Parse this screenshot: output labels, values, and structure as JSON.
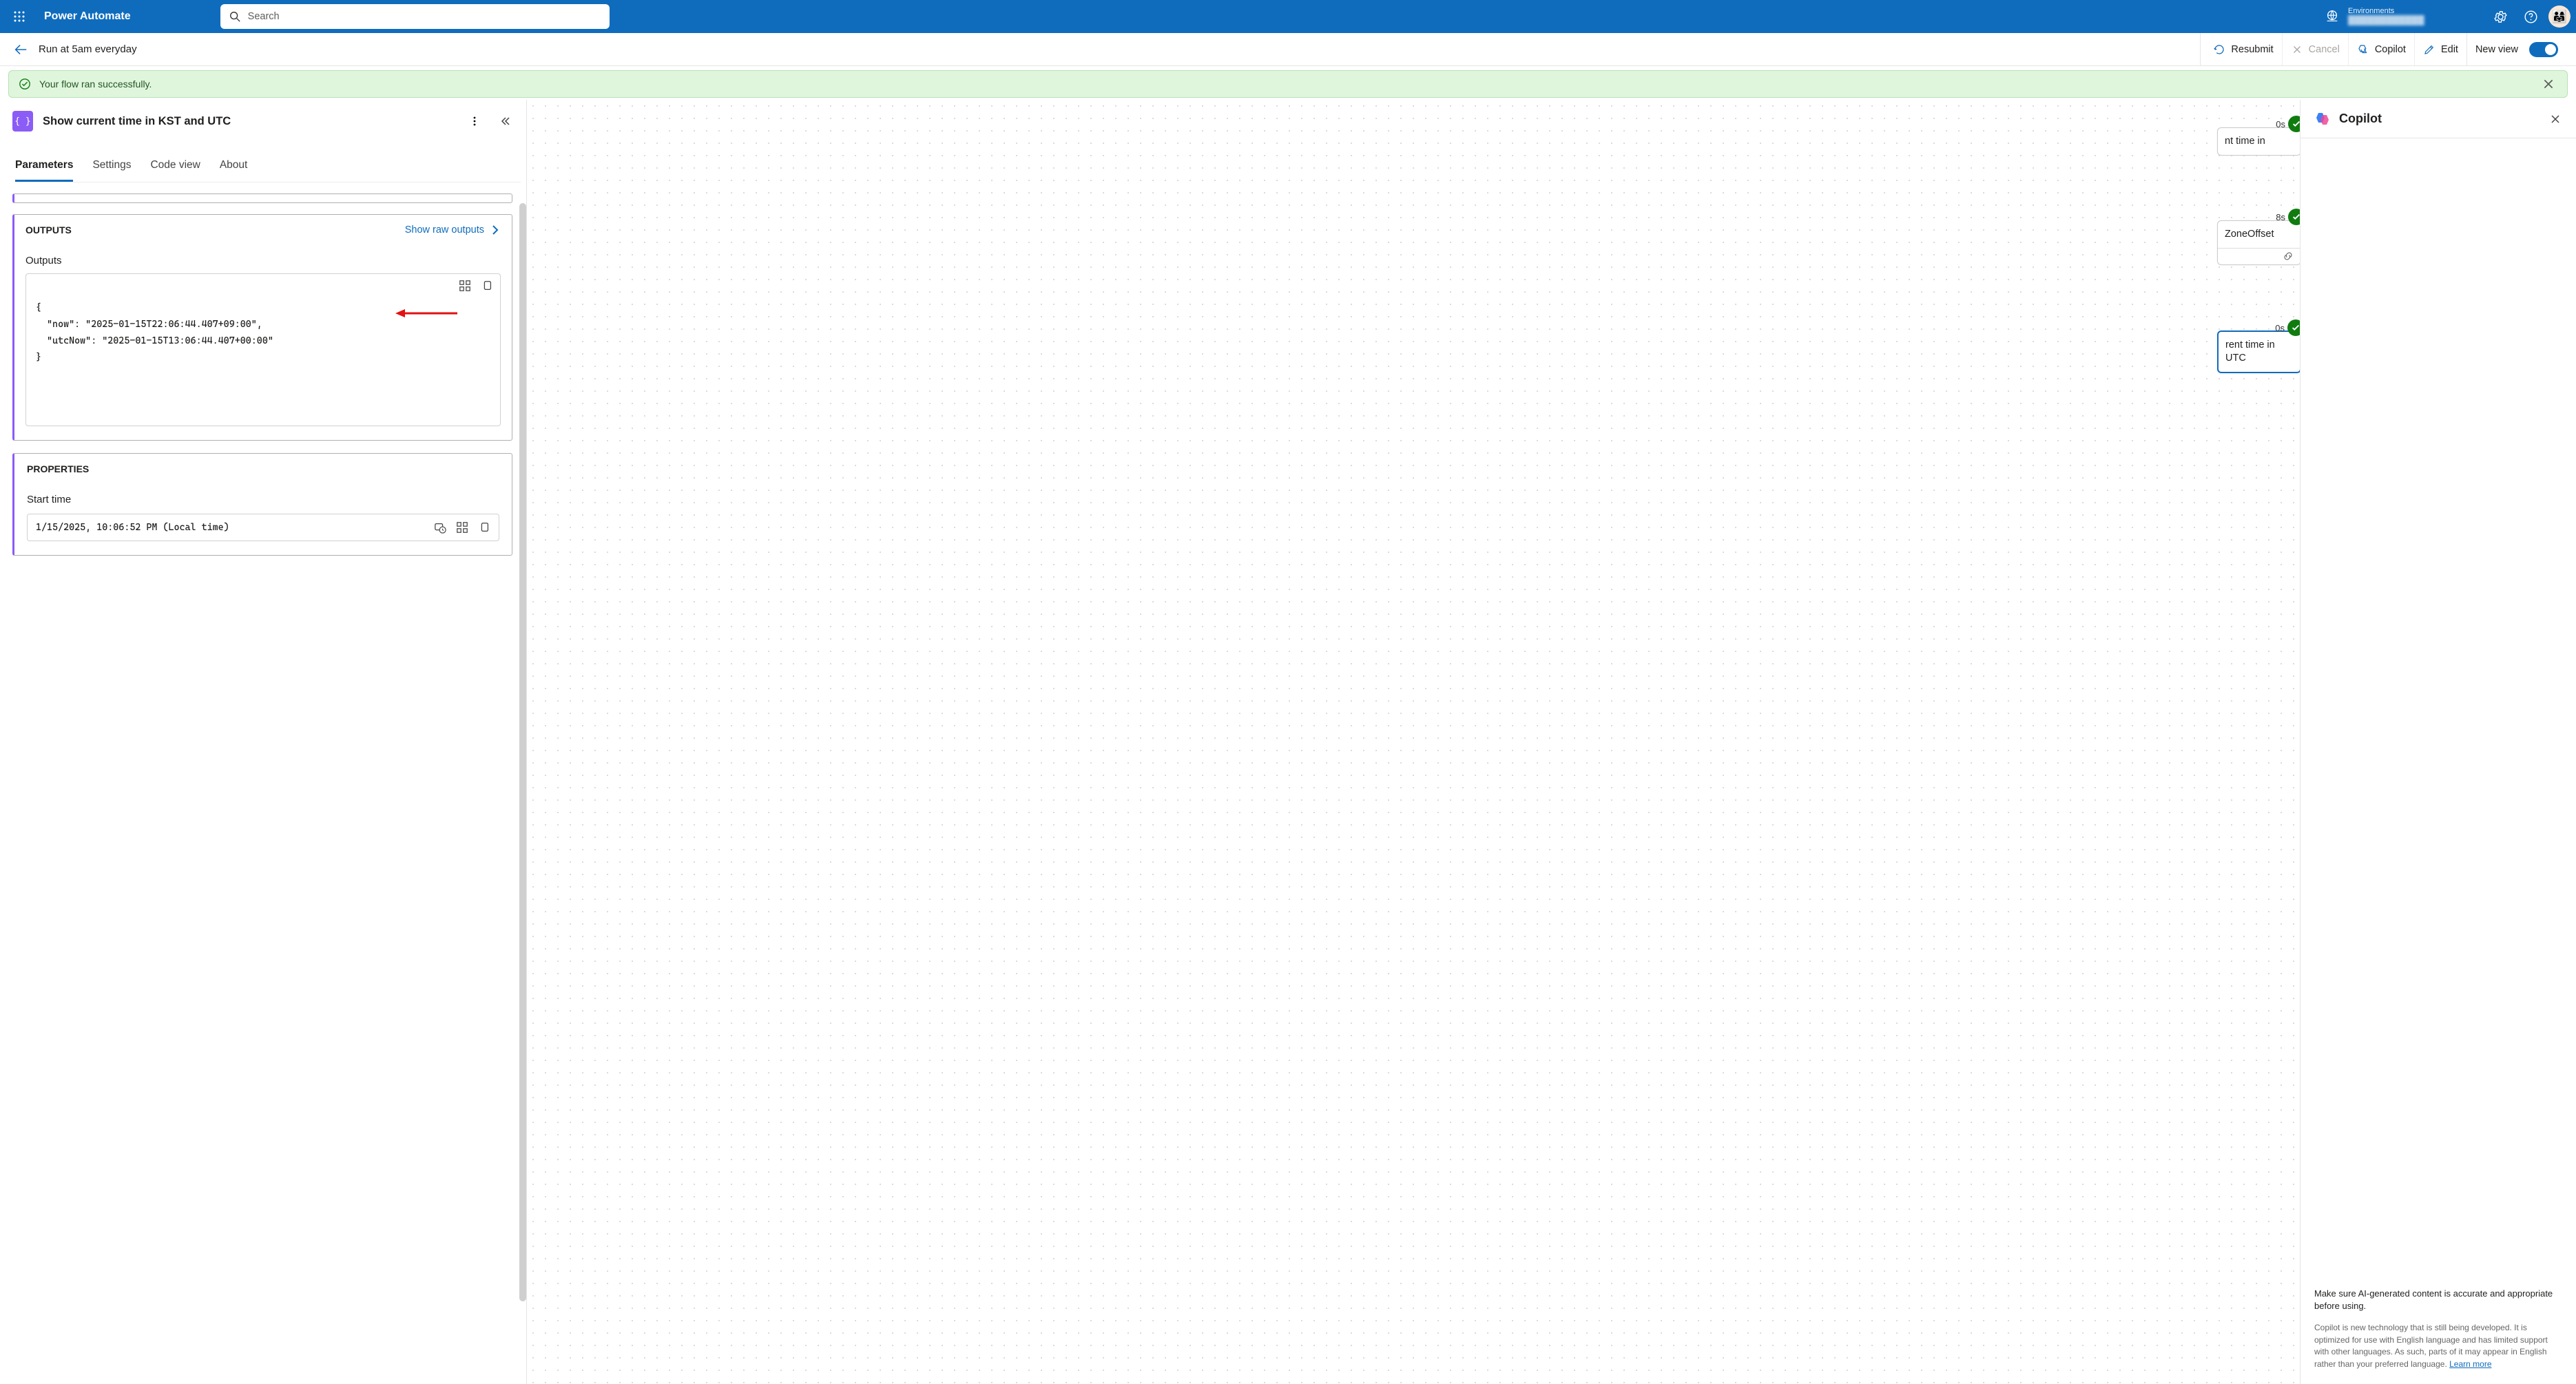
{
  "brand": "Power Automate",
  "search": {
    "placeholder": "Search"
  },
  "env": {
    "label": "Environments",
    "value": "████████████"
  },
  "cmd": {
    "flow_name": "Run at 5am everyday",
    "resubmit": "Resubmit",
    "cancel": "Cancel",
    "copilot": "Copilot",
    "edit": "Edit",
    "newview": "New view"
  },
  "banner": {
    "msg": "Your flow ran successfully."
  },
  "step": {
    "title": "Show current time in KST and UTC",
    "tabs": [
      "Parameters",
      "Settings",
      "Code view",
      "About"
    ],
    "active_tab": 0,
    "outputs_title": "OUTPUTS",
    "show_raw": "Show raw outputs",
    "outputs_label": "Outputs",
    "outputs_json": "{\n  \"now\": \"2025-01-15T22:06:44.407+09:00\",\n  \"utcNow\": \"2025-01-15T13:06:44.407+00:00\"\n}",
    "properties_title": "PROPERTIES",
    "start_time_label": "Start time",
    "start_time_value": "1/15/2025, 10:06:52 PM (Local time)"
  },
  "canvas": {
    "nodes": [
      {
        "dur": "0s",
        "text": "nt time in"
      },
      {
        "dur": "8s",
        "text": "ZoneOffset",
        "has_foot": true
      },
      {
        "dur": "0s",
        "text": "rent time in UTC",
        "selected": true
      }
    ]
  },
  "copilot": {
    "title": "Copilot",
    "disclaimer": "Make sure AI-generated content is accurate and appropriate before using.",
    "subdisc_pre": "Copilot is new technology that is still being developed. It is optimized for use with English language and has limited support with other languages. As such, parts of it may appear in English rather than your preferred language. ",
    "learn_more": "Learn more"
  }
}
